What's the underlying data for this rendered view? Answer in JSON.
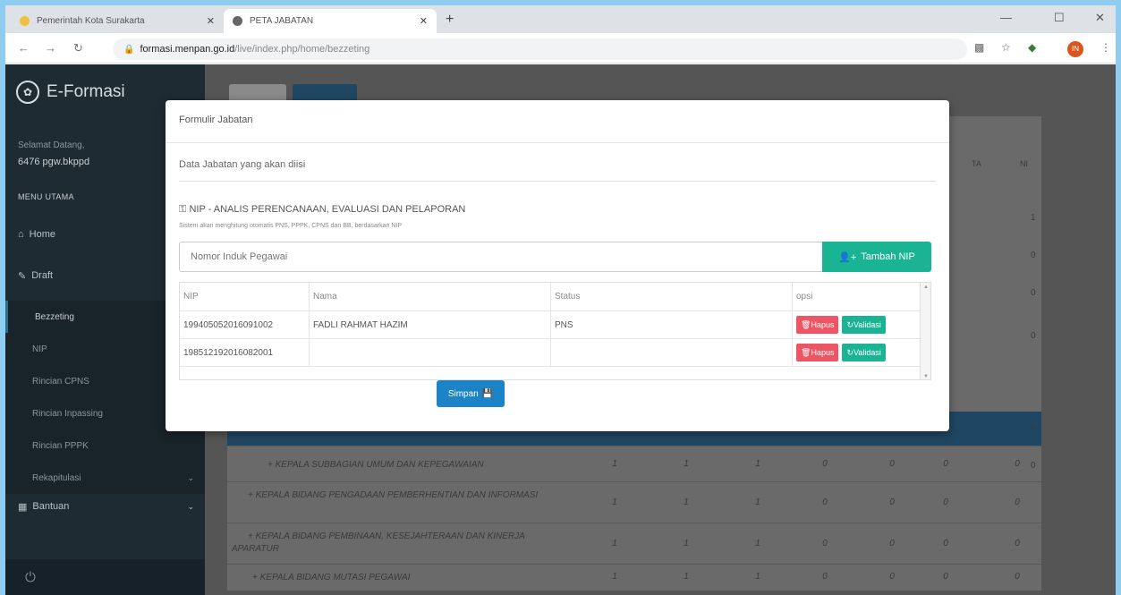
{
  "browser": {
    "tabs": [
      {
        "title": "Pemerintah Kota Surakarta",
        "close": "✕"
      },
      {
        "title": "PETA JABATAN",
        "close": "✕"
      }
    ],
    "new_tab": "+",
    "url_domain": "formasi.menpan.go.id",
    "url_path": "/live/index.php/home/bezzeting",
    "avatar": "IN"
  },
  "sidebar": {
    "brand": "E-Formasi",
    "welcome": "Selamat Datang,",
    "user": "6476 pgw.bkppd",
    "menu_header": "MENU UTAMA",
    "items": [
      {
        "label": "Home"
      },
      {
        "label": "Draft"
      },
      {
        "label": "Bezzeting"
      },
      {
        "label": "NIP"
      },
      {
        "label": "Rincian CPNS"
      },
      {
        "label": "Rincian Inpassing"
      },
      {
        "label": "Rincian PPPK"
      },
      {
        "label": "Rekapitulasi"
      },
      {
        "label": "Bantuan"
      }
    ]
  },
  "background": {
    "header_cells": [
      "TA",
      "NI"
    ],
    "rows": [
      {
        "name": "+ KEPALA SUBBAGIAN UMUM DAN KEPEGAWAIAN",
        "vals": [
          "1",
          "1",
          "1",
          "0",
          "0",
          "0",
          "0"
        ]
      },
      {
        "name": "+ KEPALA BIDANG PENGADAAN PEMBERHENTIAN DAN INFORMASI",
        "vals": [
          "1",
          "1",
          "1",
          "0",
          "0",
          "0",
          "0"
        ]
      },
      {
        "name": "+ KEPALA BIDANG PEMBINAAN, KESEJAHTERAAN DAN KINERJA APARATUR",
        "vals": [
          "1",
          "1",
          "1",
          "0",
          "0",
          "0",
          "0"
        ]
      },
      {
        "name": "+ KEPALA BIDANG MUTASI PEGAWAI",
        "vals": [
          "1",
          "1",
          "1",
          "0",
          "0",
          "0",
          "0"
        ]
      }
    ],
    "right_col": [
      "1",
      "0",
      "0",
      "0",
      "0",
      "0"
    ]
  },
  "modal": {
    "title": "Formulir Jabatan",
    "subtitle": "Data Jabatan yang akan diisi",
    "jabatan": "NIP - ANALIS PERENCANAAN, EVALUASI DAN PELAPORAN",
    "note": "Sistem akan menghitung otomatis PNS, PPPK, CPNS dan BB, berdasarkan NIP",
    "input_placeholder": "Nomor Induk Pegawai",
    "add_button": "Tambah NIP",
    "table": {
      "headers": [
        "NIP",
        "Nama",
        "Status",
        "opsi"
      ],
      "rows": [
        {
          "nip": "199405052016091002",
          "nama": "FADLI RAHMAT HAZIM",
          "status": "PNS"
        },
        {
          "nip": "198512192016082001",
          "nama": "",
          "status": ""
        }
      ],
      "delete_label": "Hapus",
      "validate_label": "Validasi"
    },
    "save_button": "Simpan"
  }
}
